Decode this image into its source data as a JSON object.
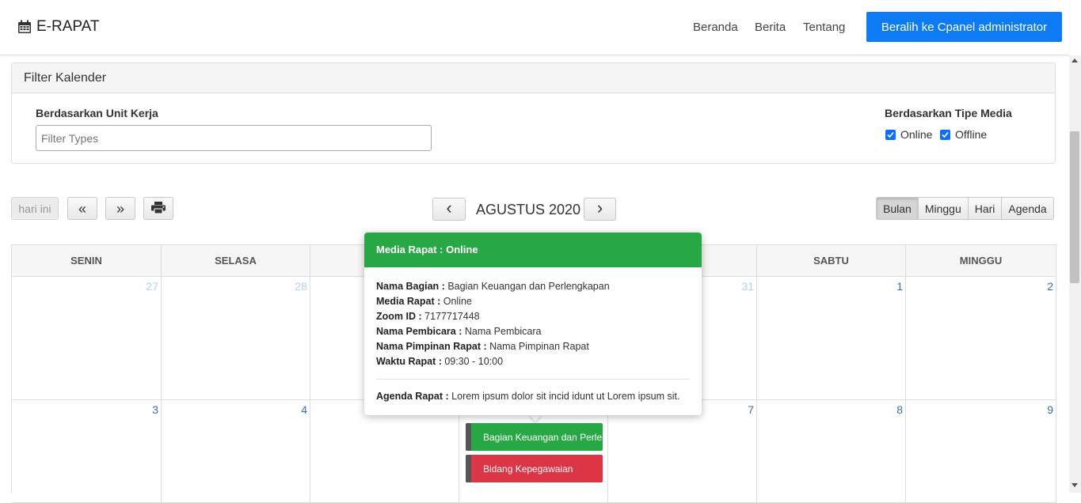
{
  "navbar": {
    "brand": "E-RAPAT",
    "links": [
      "Beranda",
      "Berita",
      "Tentang"
    ],
    "admin_button": "Beralih ke Cpanel administrator"
  },
  "filter": {
    "title": "Filter Kalender",
    "unit_label": "Berdasarkan Unit Kerja",
    "unit_placeholder": "Filter Types",
    "media_label": "Berdasarkan Tipe Media",
    "media_options": [
      {
        "label": "Online",
        "checked": true
      },
      {
        "label": "Offline",
        "checked": true
      }
    ]
  },
  "toolbar": {
    "today": "hari ini",
    "prev_year": "«",
    "next_year": "»",
    "print_icon": "print-icon",
    "prev": "‹",
    "next": "›",
    "title": "AGUSTUS 2020",
    "views": [
      "Bulan",
      "Minggu",
      "Hari",
      "Agenda"
    ],
    "active_view": "Bulan"
  },
  "calendar": {
    "headers": [
      "SENIN",
      "SELASA",
      "",
      "",
      "",
      "SABTU",
      "MINGGU"
    ],
    "week1": [
      "27",
      "28",
      "",
      "",
      "31",
      "1",
      "2"
    ],
    "week2": [
      "3",
      "4",
      "",
      "",
      "7",
      "8",
      "9"
    ],
    "events": [
      {
        "label": "Bagian Keuangan dan Perlengkapan",
        "color": "#28a745"
      },
      {
        "label": "Bidang Kepegawaian",
        "color": "#dc3545"
      }
    ]
  },
  "popover": {
    "header": "Media Rapat : Online",
    "rows": [
      {
        "key": "Nama Bagian :",
        "value": " Bagian Keuangan dan Perlengkapan"
      },
      {
        "key": "Media Rapat :",
        "value": " Online"
      },
      {
        "key": "Zoom ID :",
        "value": " 7177717448"
      },
      {
        "key": "Nama Pembicara :",
        "value": " Nama Pembicara"
      },
      {
        "key": "Nama Pimpinan Rapat :",
        "value": " Nama Pimpinan Rapat"
      },
      {
        "key": "Waktu Rapat :",
        "value": " 09:30 - 10:00"
      }
    ],
    "agenda_key": "Agenda Rapat :",
    "agenda_value": " Lorem ipsum dolor sit incid idunt ut Lorem ipsum sit."
  },
  "colors": {
    "primary": "#0d7bf3",
    "online": "#28a745",
    "offline_event": "#dc3545"
  }
}
